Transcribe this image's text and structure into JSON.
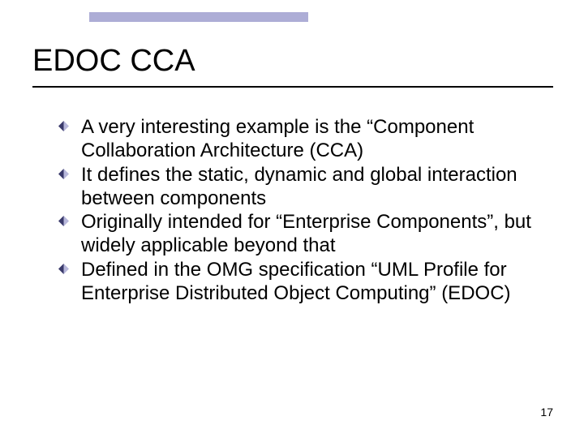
{
  "slide": {
    "title": "EDOC CCA",
    "bullets": [
      "A very interesting example is the “Component Collaboration Architecture (CCA)",
      "It defines the static, dynamic and global interaction between components",
      "Originally intended for “Enterprise Components”, but widely applicable beyond that",
      "Defined in the OMG specification “UML Profile for Enterprise Distributed Object Computing” (EDOC)"
    ],
    "page_number": "17"
  },
  "colors": {
    "bullet_top": "#3a3a6b",
    "bullet_bottom": "#b8b8db",
    "band": "#adadd6"
  }
}
